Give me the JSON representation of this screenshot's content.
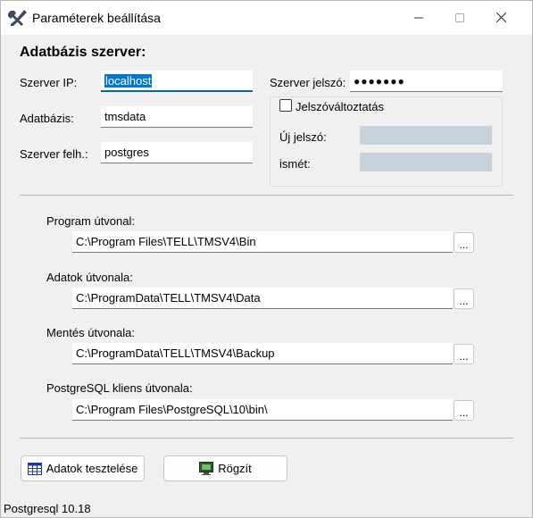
{
  "window": {
    "title": "Paraméterek beállítása",
    "icon": "tools-icon",
    "minimize_icon": "minimize-icon",
    "maximize_icon": "maximize-icon",
    "close_icon": "close-icon"
  },
  "server": {
    "heading": "Adatbázis szerver:",
    "ip_label": "Szerver IP:",
    "ip_value": "localhost",
    "db_label": "Adatbázis:",
    "db_value": "tmsdata",
    "user_label": "Szerver felh.:",
    "user_value": "postgres",
    "password_label": "Szerver jelszó:",
    "password_value": "●●●●●●●",
    "change_password_label": "Jelszóváltoztatás",
    "change_password_checked": false,
    "new_password_label": "Új jelszó:",
    "new_password_value": "",
    "repeat_label": "ismét:",
    "repeat_value": ""
  },
  "paths": [
    {
      "label": "Program útvonal:",
      "value": "C:\\Program Files\\TELL\\TMSV4\\Bin",
      "browse": "..."
    },
    {
      "label": "Adatok útvonala:",
      "value": "C:\\ProgramData\\TELL\\TMSV4\\Data",
      "browse": "..."
    },
    {
      "label": "Mentés útvonala:",
      "value": "C:\\ProgramData\\TELL\\TMSV4\\Backup",
      "browse": "..."
    },
    {
      "label": "PostgreSQL kliens útvonala:",
      "value": "C:\\Program Files\\PostgreSQL\\10\\bin\\",
      "browse": "..."
    }
  ],
  "buttons": {
    "test_label": "Adatok tesztelése",
    "test_icon": "table-icon",
    "save_label": "Rögzít",
    "save_icon": "monitor-icon"
  },
  "status": {
    "text": "Postgresql 10.18"
  },
  "colors": {
    "selection": "#0078d7",
    "focus_underline": "#0067c0",
    "disabled_field": "#c8d2dc",
    "background": "#f0f0f0"
  }
}
